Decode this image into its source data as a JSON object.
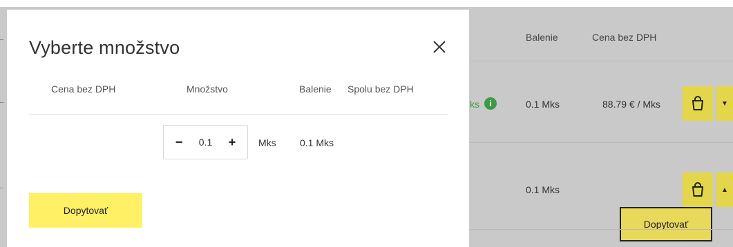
{
  "background": {
    "headers": {
      "balenie": "Balenie",
      "cena": "Cena bez DPH"
    },
    "rows": [
      {
        "stock_partial": "ks",
        "info_icon": "i",
        "balenie": "0.1 Mks",
        "cena": "88.79 € / Mks"
      },
      {
        "balenie": "0.1 Mks",
        "cena": ""
      }
    ],
    "dopytovat_label": "Dopytovať"
  },
  "modal": {
    "title": "Vyberte množstvo",
    "headers": {
      "cena": "Cena bez DPH",
      "mnozstvo": "Množstvo",
      "balenie": "Balenie",
      "spolu": "Spolu bez DPH"
    },
    "stepper": {
      "minus": "−",
      "value": "0.1",
      "plus": "+"
    },
    "unit": "Mks",
    "balenie_value": "0.1 Mks",
    "dopytovat_label": "Dopytovať"
  },
  "colors": {
    "accent_yellow": "#fff066",
    "dim_yellow": "#e3d64a",
    "green": "#3f9a45"
  },
  "icons": [
    "close-icon",
    "info-icon",
    "shopping-bag-icon",
    "caret-down-icon",
    "caret-up-icon"
  ]
}
